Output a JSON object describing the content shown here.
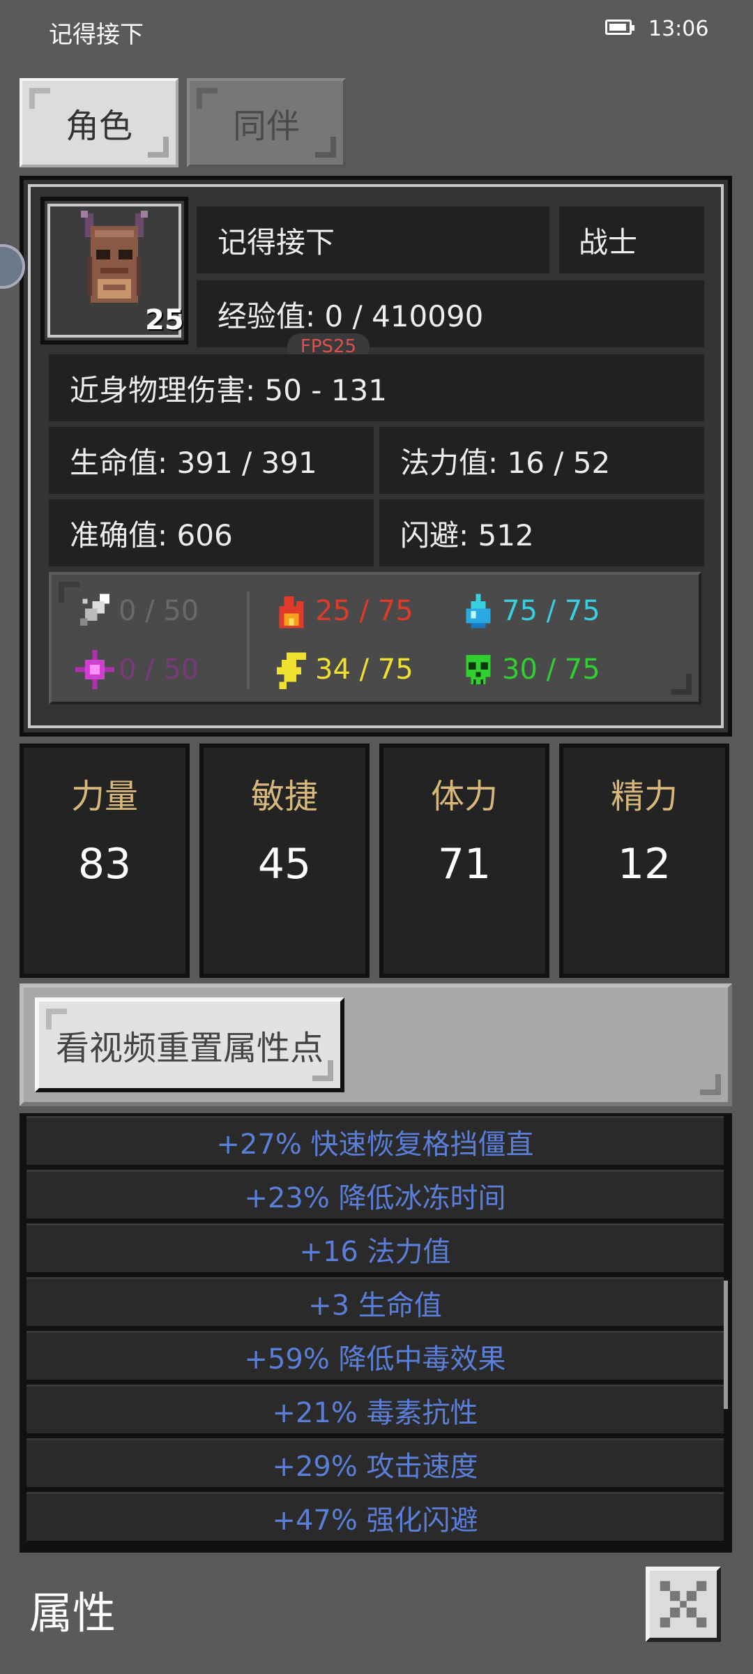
{
  "status_bar": {
    "app_name": "记得接下",
    "time": "13:06"
  },
  "tabs": [
    {
      "label": "角色"
    },
    {
      "label": "同伴"
    }
  ],
  "character": {
    "name": "记得接下",
    "class": "战士",
    "level": "25",
    "experience": "经验值: 0 / 410090",
    "fps": "FPS25",
    "melee_damage": "近身物理伤害: 50 - 131",
    "hp": "生命值: 391 / 391",
    "mp": "法力值: 16 / 52",
    "accuracy": "准确值: 606",
    "dodge": "闪避: 512"
  },
  "resistances": {
    "physical": {
      "value": "0 / 50",
      "color": "#6a6a6a",
      "icon": "sword-icon"
    },
    "fire": {
      "value": "25 / 75",
      "color": "#e03a2a",
      "icon": "fire-icon"
    },
    "cold": {
      "value": "75 / 75",
      "color": "#38d0e0",
      "icon": "water-drop-icon"
    },
    "magic": {
      "value": "0 / 50",
      "color": "#7a3a7a",
      "icon": "magic-star-icon"
    },
    "lightning": {
      "value": "34 / 75",
      "color": "#f0e030",
      "icon": "lightning-icon"
    },
    "poison": {
      "value": "30 / 75",
      "color": "#30d030",
      "icon": "skull-icon"
    }
  },
  "stats": [
    {
      "label": "力量",
      "value": "83"
    },
    {
      "label": "敏捷",
      "value": "45"
    },
    {
      "label": "体力",
      "value": "71"
    },
    {
      "label": "精力",
      "value": "12"
    }
  ],
  "reset_button": {
    "label": "看视频重置属性点"
  },
  "attributes": [
    "+27% 快速恢复格挡僵直",
    "+23% 降低冰冻时间",
    "+16 法力值",
    "+3 生命值",
    "+59% 降低中毒效果",
    "+21% 毒素抗性",
    "+29% 攻击速度",
    "+47% 强化闪避"
  ],
  "footer": {
    "title": "属性"
  }
}
